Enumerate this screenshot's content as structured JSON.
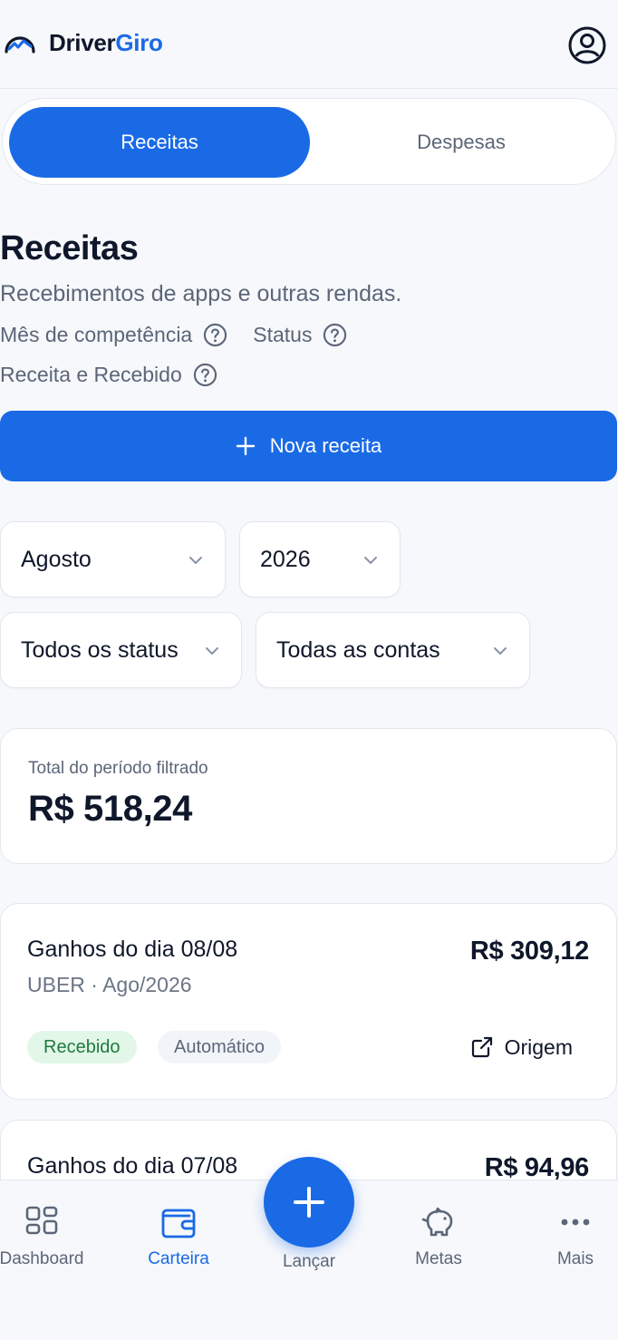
{
  "header": {
    "brand_part1": "Driver",
    "brand_part2": "Giro",
    "profile_icon": "user-circle-icon"
  },
  "tabs": [
    {
      "label": "Receitas",
      "active": true
    },
    {
      "label": "Despesas",
      "active": false
    }
  ],
  "page": {
    "title": "Receitas",
    "subtitle": "Recebimentos de apps e outras rendas.",
    "help_items": [
      "Mês de competência",
      "Status",
      "Receita e Recebido"
    ]
  },
  "new_button": {
    "label": "Nova receita",
    "icon": "plus-icon"
  },
  "filters": {
    "month": "Agosto",
    "year": "2026",
    "status": "Todos os status",
    "account": "Todas as contas"
  },
  "total": {
    "label": "Total do período filtrado",
    "value": "R$ 518,24"
  },
  "entries": [
    {
      "title": "Ganhos do dia 08/08",
      "subtitle": "UBER · Ago/2026",
      "amount": "R$ 309,12",
      "status_badge": "Recebido",
      "type_badge": "Automático",
      "link_label": "Origem"
    },
    {
      "title": "Ganhos do dia 07/08",
      "amount": "R$ 94,96"
    }
  ],
  "bottom_nav": {
    "items": [
      {
        "label": "Dashboard",
        "icon": "grid-icon"
      },
      {
        "label": "Carteira",
        "icon": "wallet-icon",
        "active": true
      },
      {
        "label": "Metas",
        "icon": "piggy-bank-icon"
      },
      {
        "label": "Mais",
        "icon": "more-dots-icon"
      }
    ],
    "fab_label": "Lançar"
  },
  "colors": {
    "primary": "#1a6ae6",
    "background": "#f6f8fb",
    "text": "#0f172a",
    "muted": "#5b6678",
    "success_bg": "#e2f7e8",
    "success_text": "#1f7a3f"
  }
}
